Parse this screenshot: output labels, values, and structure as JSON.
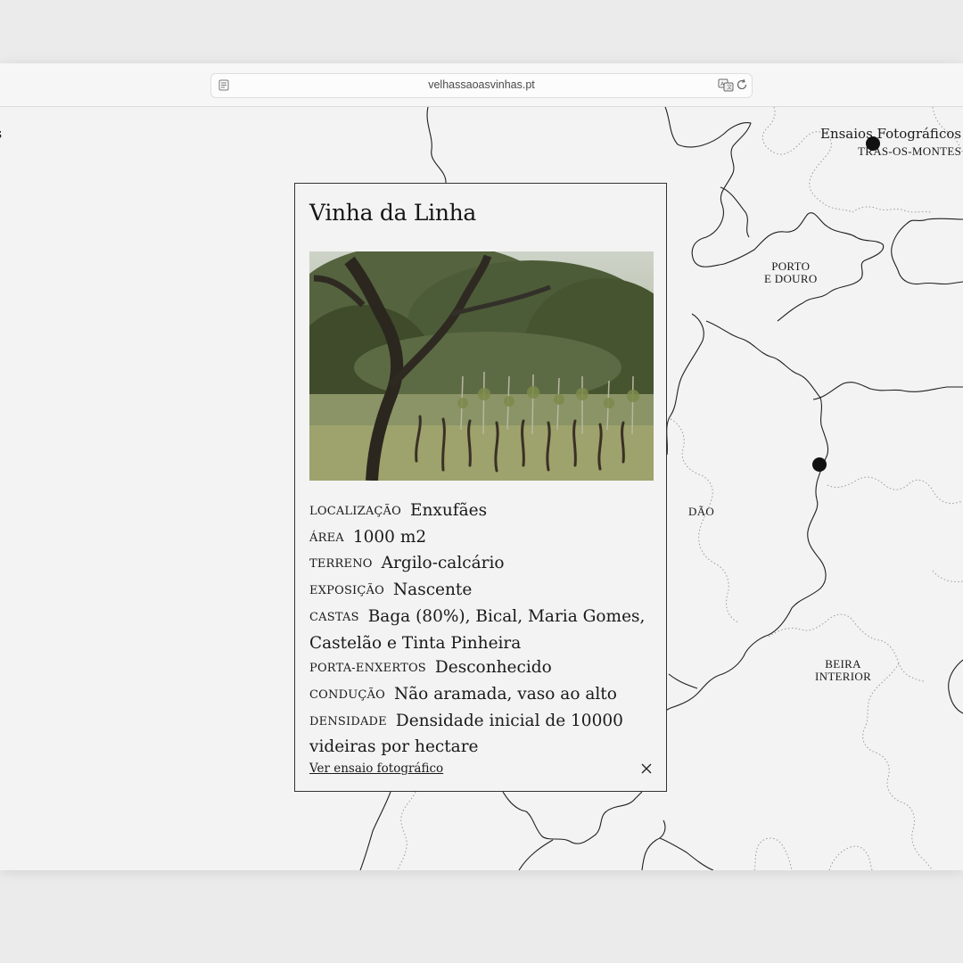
{
  "browser": {
    "url": "velhassaoasvinhas.pt"
  },
  "site": {
    "left_cut_text": "s",
    "nav_link": "Ensaios Fotográficos"
  },
  "map": {
    "regions": [
      {
        "id": "tras-os-montes",
        "label": "TRÁS-OS-MONTES"
      },
      {
        "id": "porto-e-douro",
        "label": "PORTO\nE DOURO"
      },
      {
        "id": "dao",
        "label": "DÃO"
      },
      {
        "id": "beira-interior",
        "label": "BEIRA\nINTERIOR"
      }
    ]
  },
  "card": {
    "title": "Vinha da Linha",
    "details": [
      {
        "label": "LOCALIZAÇÃO",
        "value": "Enxufães"
      },
      {
        "label": "ÁREA",
        "value": "1000 m2"
      },
      {
        "label": "TERRENO",
        "value": "Argilo-calcário"
      },
      {
        "label": "EXPOSIÇÃO",
        "value": "Nascente"
      },
      {
        "label": "CASTAS",
        "value": "Baga (80%), Bical, Maria Gomes, Castelão e Tinta Pinheira"
      },
      {
        "label": "PORTA-ENXERTOS",
        "value": "Desconhecido"
      },
      {
        "label": "CONDUÇÃO",
        "value": "Não aramada, vaso ao alto"
      },
      {
        "label": "DENSIDADE",
        "value": "Densidade inicial de 10000 videiras por hectare"
      }
    ],
    "link_label": "Ver ensaio fotográfico"
  },
  "colors": {
    "page_background": "#ebebeb",
    "map_background": "#f3f3f3",
    "ink": "#1a1a1a"
  }
}
